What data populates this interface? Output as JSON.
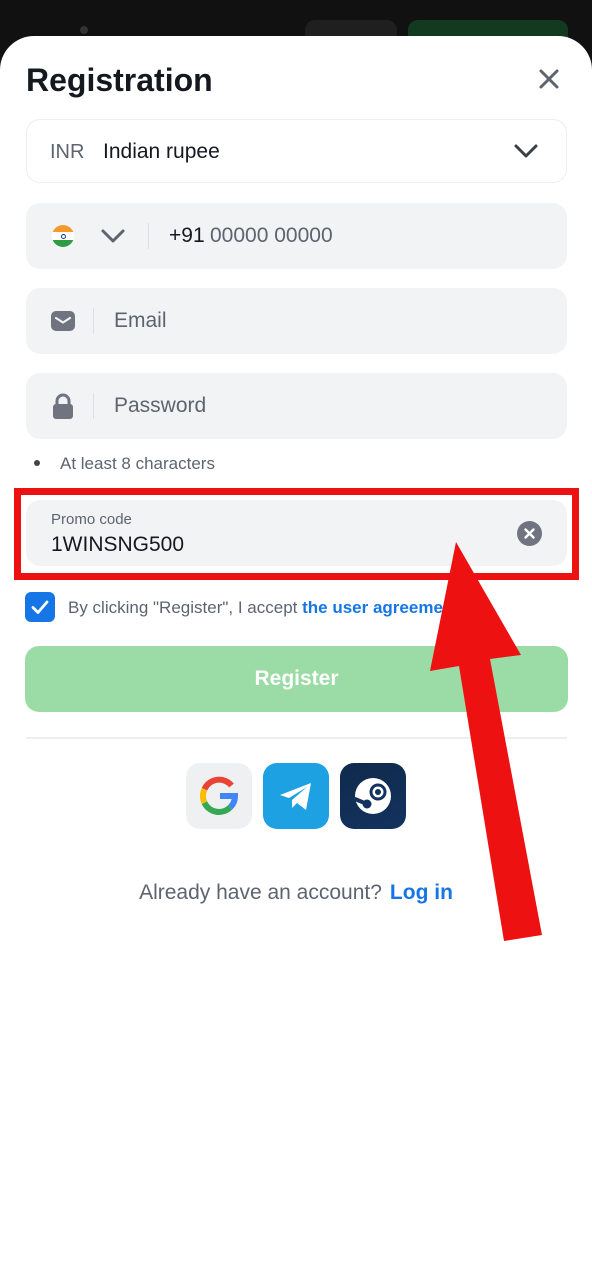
{
  "dialog": {
    "title": "Registration"
  },
  "currency": {
    "code": "INR",
    "name": "Indian rupee"
  },
  "phone": {
    "prefix": "+91",
    "placeholder": "00000 00000"
  },
  "email": {
    "placeholder": "Email"
  },
  "password": {
    "placeholder": "Password",
    "hint": "At least 8 characters"
  },
  "promo": {
    "label": "Promo code",
    "value": "1WINSNG500"
  },
  "agreement": {
    "checked": true,
    "text": "By clicking \"Register\", I accept ",
    "link": "the user agreement"
  },
  "register_label": "Register",
  "social": [
    "google-icon",
    "telegram-icon",
    "steam-icon"
  ],
  "login_prompt": {
    "text": "Already have an account?",
    "link": "Log in"
  },
  "colors": {
    "accent": "#1776e6",
    "register_disabled": "#9bdba6",
    "highlight": "#ee1111"
  }
}
